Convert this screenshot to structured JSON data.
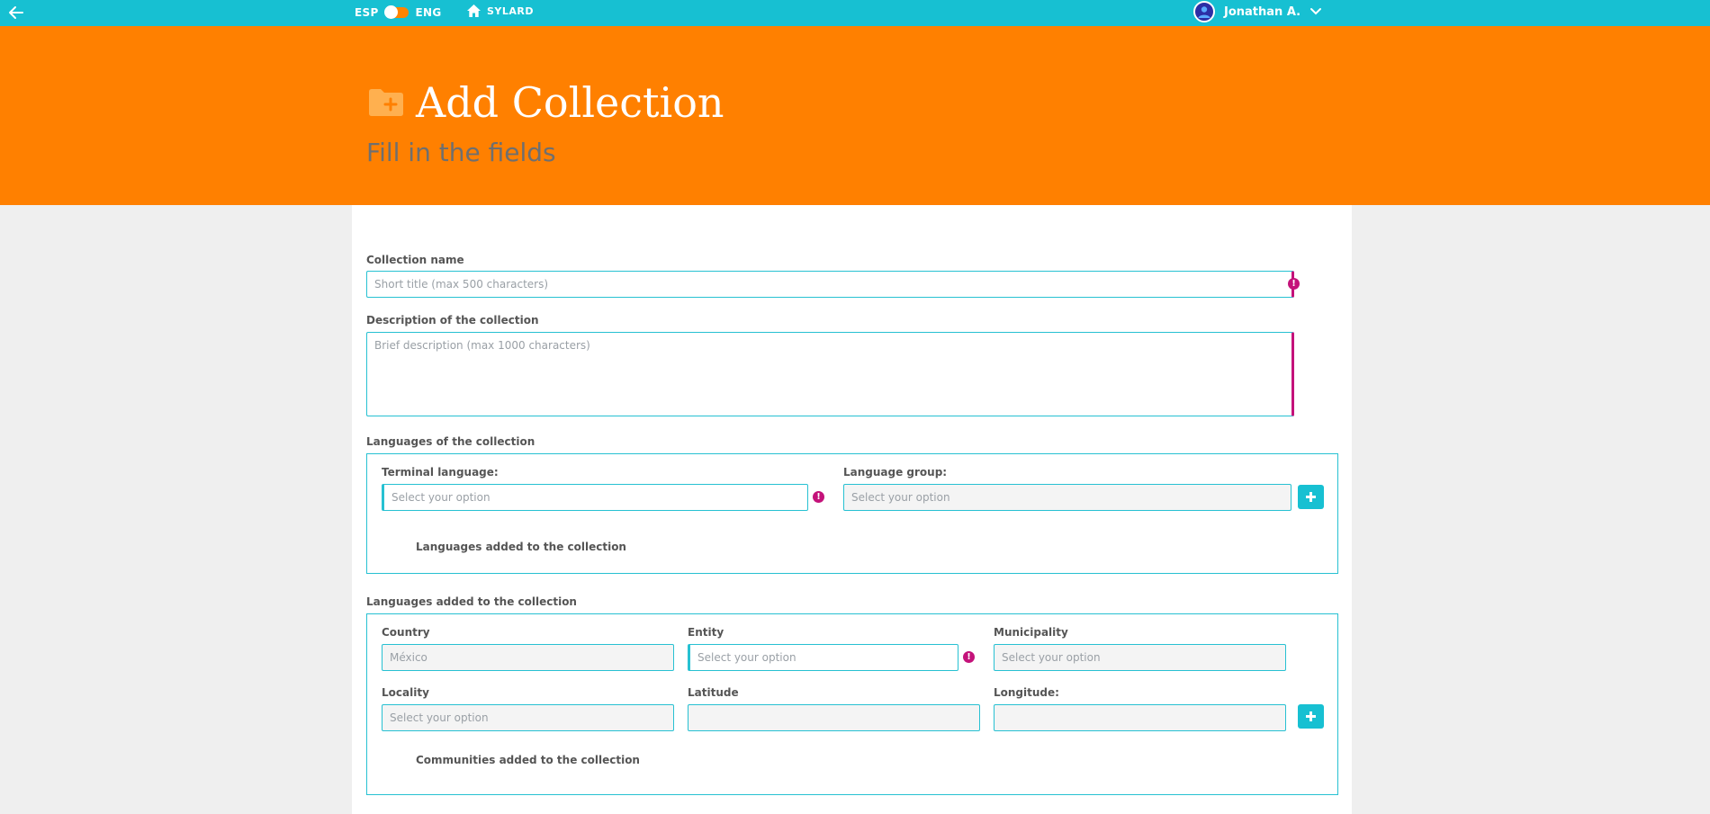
{
  "topbar": {
    "lang_left": "ESP",
    "lang_right": "ENG",
    "home_label": "SYLARD",
    "user_name": "Jonathan A."
  },
  "header": {
    "title": "Add Collection",
    "subtitle": "Fill in the fields"
  },
  "form": {
    "collection_name": {
      "label": "Collection name",
      "placeholder": "Short title (max 500 characters)"
    },
    "description": {
      "label": "Description of the collection",
      "placeholder": "Brief description (max 1000 characters)"
    },
    "languages": {
      "section_label": "Languages of the collection",
      "terminal_label": "Terminal language:",
      "terminal_placeholder": "Select your option",
      "group_label": "Language group:",
      "group_placeholder": "Select your option",
      "added_label": "Languages added to the collection"
    },
    "communities": {
      "section_label": "Languages added to the collection",
      "country_label": "Country",
      "country_value": "México",
      "entity_label": "Entity",
      "entity_placeholder": "Select your option",
      "municipality_label": "Municipality",
      "municipality_placeholder": "Select your option",
      "locality_label": "Locality",
      "locality_placeholder": "Select your option",
      "latitude_label": "Latitude",
      "longitude_label": "Longitude:",
      "added_label": "Communities added to the collection"
    }
  },
  "colors": {
    "topbar": "#17c0d2",
    "header": "#ff8000",
    "error": "#c4127a"
  }
}
